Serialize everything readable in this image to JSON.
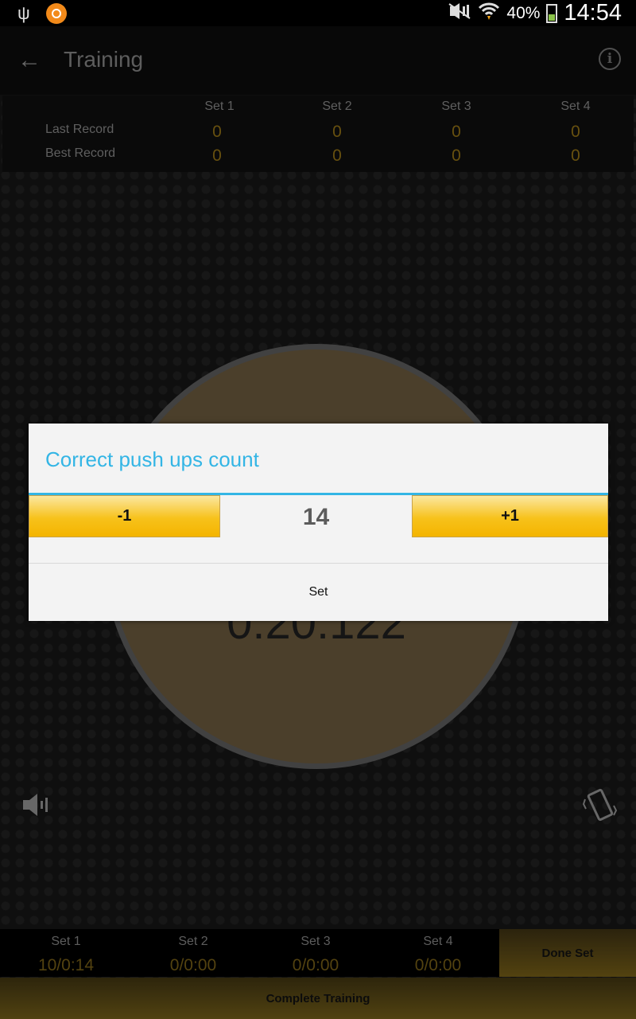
{
  "status_bar": {
    "battery_percent": "40%",
    "time": "14:54",
    "icons": [
      "usb-icon",
      "app-notification-icon",
      "mute-icon",
      "wifi-icon",
      "battery-icon"
    ]
  },
  "action_bar": {
    "title": "Training",
    "icons": [
      "back-arrow-icon",
      "info-icon"
    ]
  },
  "records": {
    "headers": [
      "Set 1",
      "Set 2",
      "Set 3",
      "Set 4"
    ],
    "rows": [
      {
        "label": "Last Record",
        "values": [
          "0",
          "0",
          "0",
          "0"
        ]
      },
      {
        "label": "Best Record",
        "values": [
          "0",
          "0",
          "0",
          "0"
        ]
      }
    ]
  },
  "timer": {
    "text": "0:20:122"
  },
  "controls": {
    "icons": [
      "sound-icon",
      "vibrate-icon"
    ]
  },
  "sets_bar": {
    "sets": [
      {
        "name": "Set 1",
        "value": "10/0:14"
      },
      {
        "name": "Set 2",
        "value": "0/0:00"
      },
      {
        "name": "Set 3",
        "value": "0/0:00"
      },
      {
        "name": "Set 4",
        "value": "0/0:00"
      }
    ],
    "done_label": "Done Set",
    "complete_label": "Complete Training"
  },
  "dialog": {
    "title": "Correct push ups count",
    "minus_label": "-1",
    "plus_label": "+1",
    "count": "14",
    "set_label": "Set"
  },
  "colors": {
    "accent_blue": "#33b5e5",
    "gold_button": "#f7c21b",
    "record_value": "#8a6b14",
    "circle_fill": "#65553a"
  }
}
